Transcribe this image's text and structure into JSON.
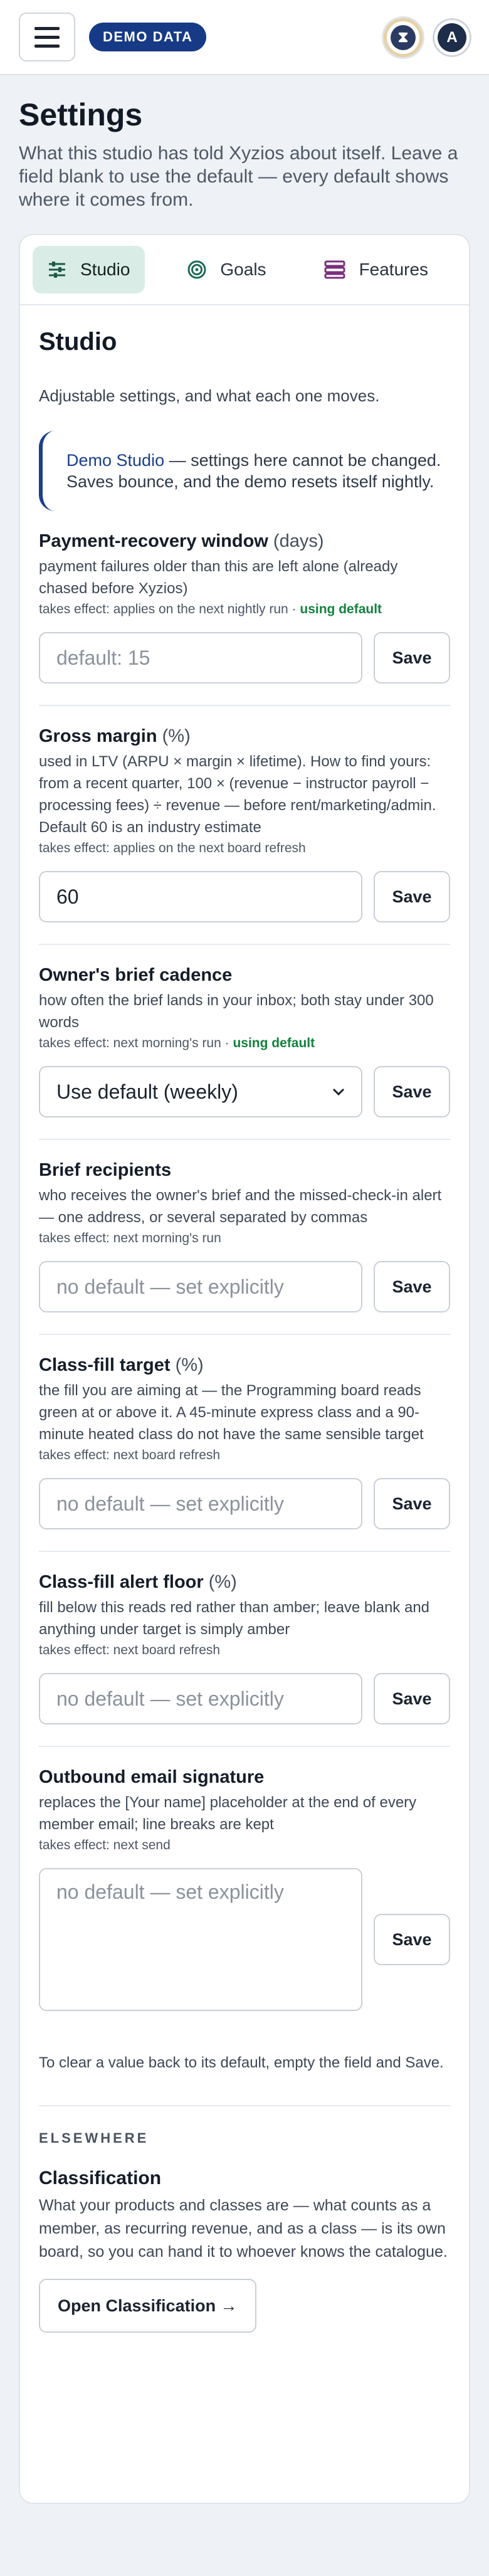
{
  "header": {
    "badge": "DEMO DATA",
    "hourglass_glyph": "⧗",
    "avatar_letter": "A"
  },
  "page": {
    "title": "Settings",
    "subtitle": "What this studio has told Xyzios about itself. Leave a field blank to use the default — every default shows where it comes from."
  },
  "tabs": [
    {
      "label": "Studio",
      "icon": "sliders-icon",
      "active": true
    },
    {
      "label": "Goals",
      "icon": "target-icon",
      "active": false
    },
    {
      "label": "Features",
      "icon": "layers-icon",
      "active": false
    }
  ],
  "section": {
    "title": "Studio",
    "description": "Adjustable settings, and what each one moves.",
    "demo_name": "Demo Studio",
    "demo_note": " — settings here cannot be changed. Saves bounce, and the demo resets itself nightly."
  },
  "save_label": "Save",
  "settings": [
    {
      "name": "Payment-recovery window",
      "unit": "(days)",
      "description": "payment failures older than this are left alone (already chased before Xyzios)",
      "effect": "takes effect: applies on the next nightly run · ",
      "default_flag": "using default",
      "value": "",
      "placeholder": "default: 15"
    },
    {
      "name": "Gross margin",
      "unit": "(%)",
      "description": "used in LTV (ARPU × margin × lifetime). How to find yours: from a recent quarter, 100 × (revenue − instructor payroll − processing fees) ÷ revenue — before rent/marketing/admin. Default 60 is an industry estimate",
      "effect": "takes effect: applies on the next board refresh",
      "default_flag": "",
      "value": "60",
      "placeholder": ""
    },
    {
      "name": "Owner's brief cadence",
      "unit": "",
      "description": "how often the brief lands in your inbox; both stay under 300 words",
      "effect": "takes effect: next morning's run · ",
      "default_flag": "using default",
      "value": "Use default (weekly)",
      "placeholder": ""
    },
    {
      "name": "Brief recipients",
      "unit": "",
      "description": "who receives the owner's brief and the missed-check-in alert — one address, or several separated by commas",
      "effect": "takes effect: next morning's run",
      "default_flag": "",
      "value": "",
      "placeholder": "no default — set explicitly"
    },
    {
      "name": "Class-fill target",
      "unit": "(%)",
      "description": "the fill you are aiming at — the Programming board reads green at or above it. A 45-minute express class and a 90-minute heated class do not have the same sensible target",
      "effect": "takes effect: next board refresh",
      "default_flag": "",
      "value": "",
      "placeholder": "no default — set explicitly"
    },
    {
      "name": "Class-fill alert floor",
      "unit": "(%)",
      "description": "fill below this reads red rather than amber; leave blank and anything under target is simply amber",
      "effect": "takes effect: next board refresh",
      "default_flag": "",
      "value": "",
      "placeholder": "no default — set explicitly"
    },
    {
      "name": "Outbound email signature",
      "unit": "",
      "description": "replaces the [Your name] placeholder at the end of every member email; line breaks are kept",
      "effect": "takes effect: next send",
      "default_flag": "",
      "value": "",
      "placeholder": "no default — set explicitly"
    }
  ],
  "clear_note": "To clear a value back to its default, empty the field and Save.",
  "elsewhere": {
    "label": "ELSEWHERE",
    "title": "Classification",
    "description": "What your products and classes are — what counts as a member, as recurring revenue, and as a class — is its own board, so you can hand it to whoever knows the catalogue.",
    "button": "Open Classification →"
  }
}
